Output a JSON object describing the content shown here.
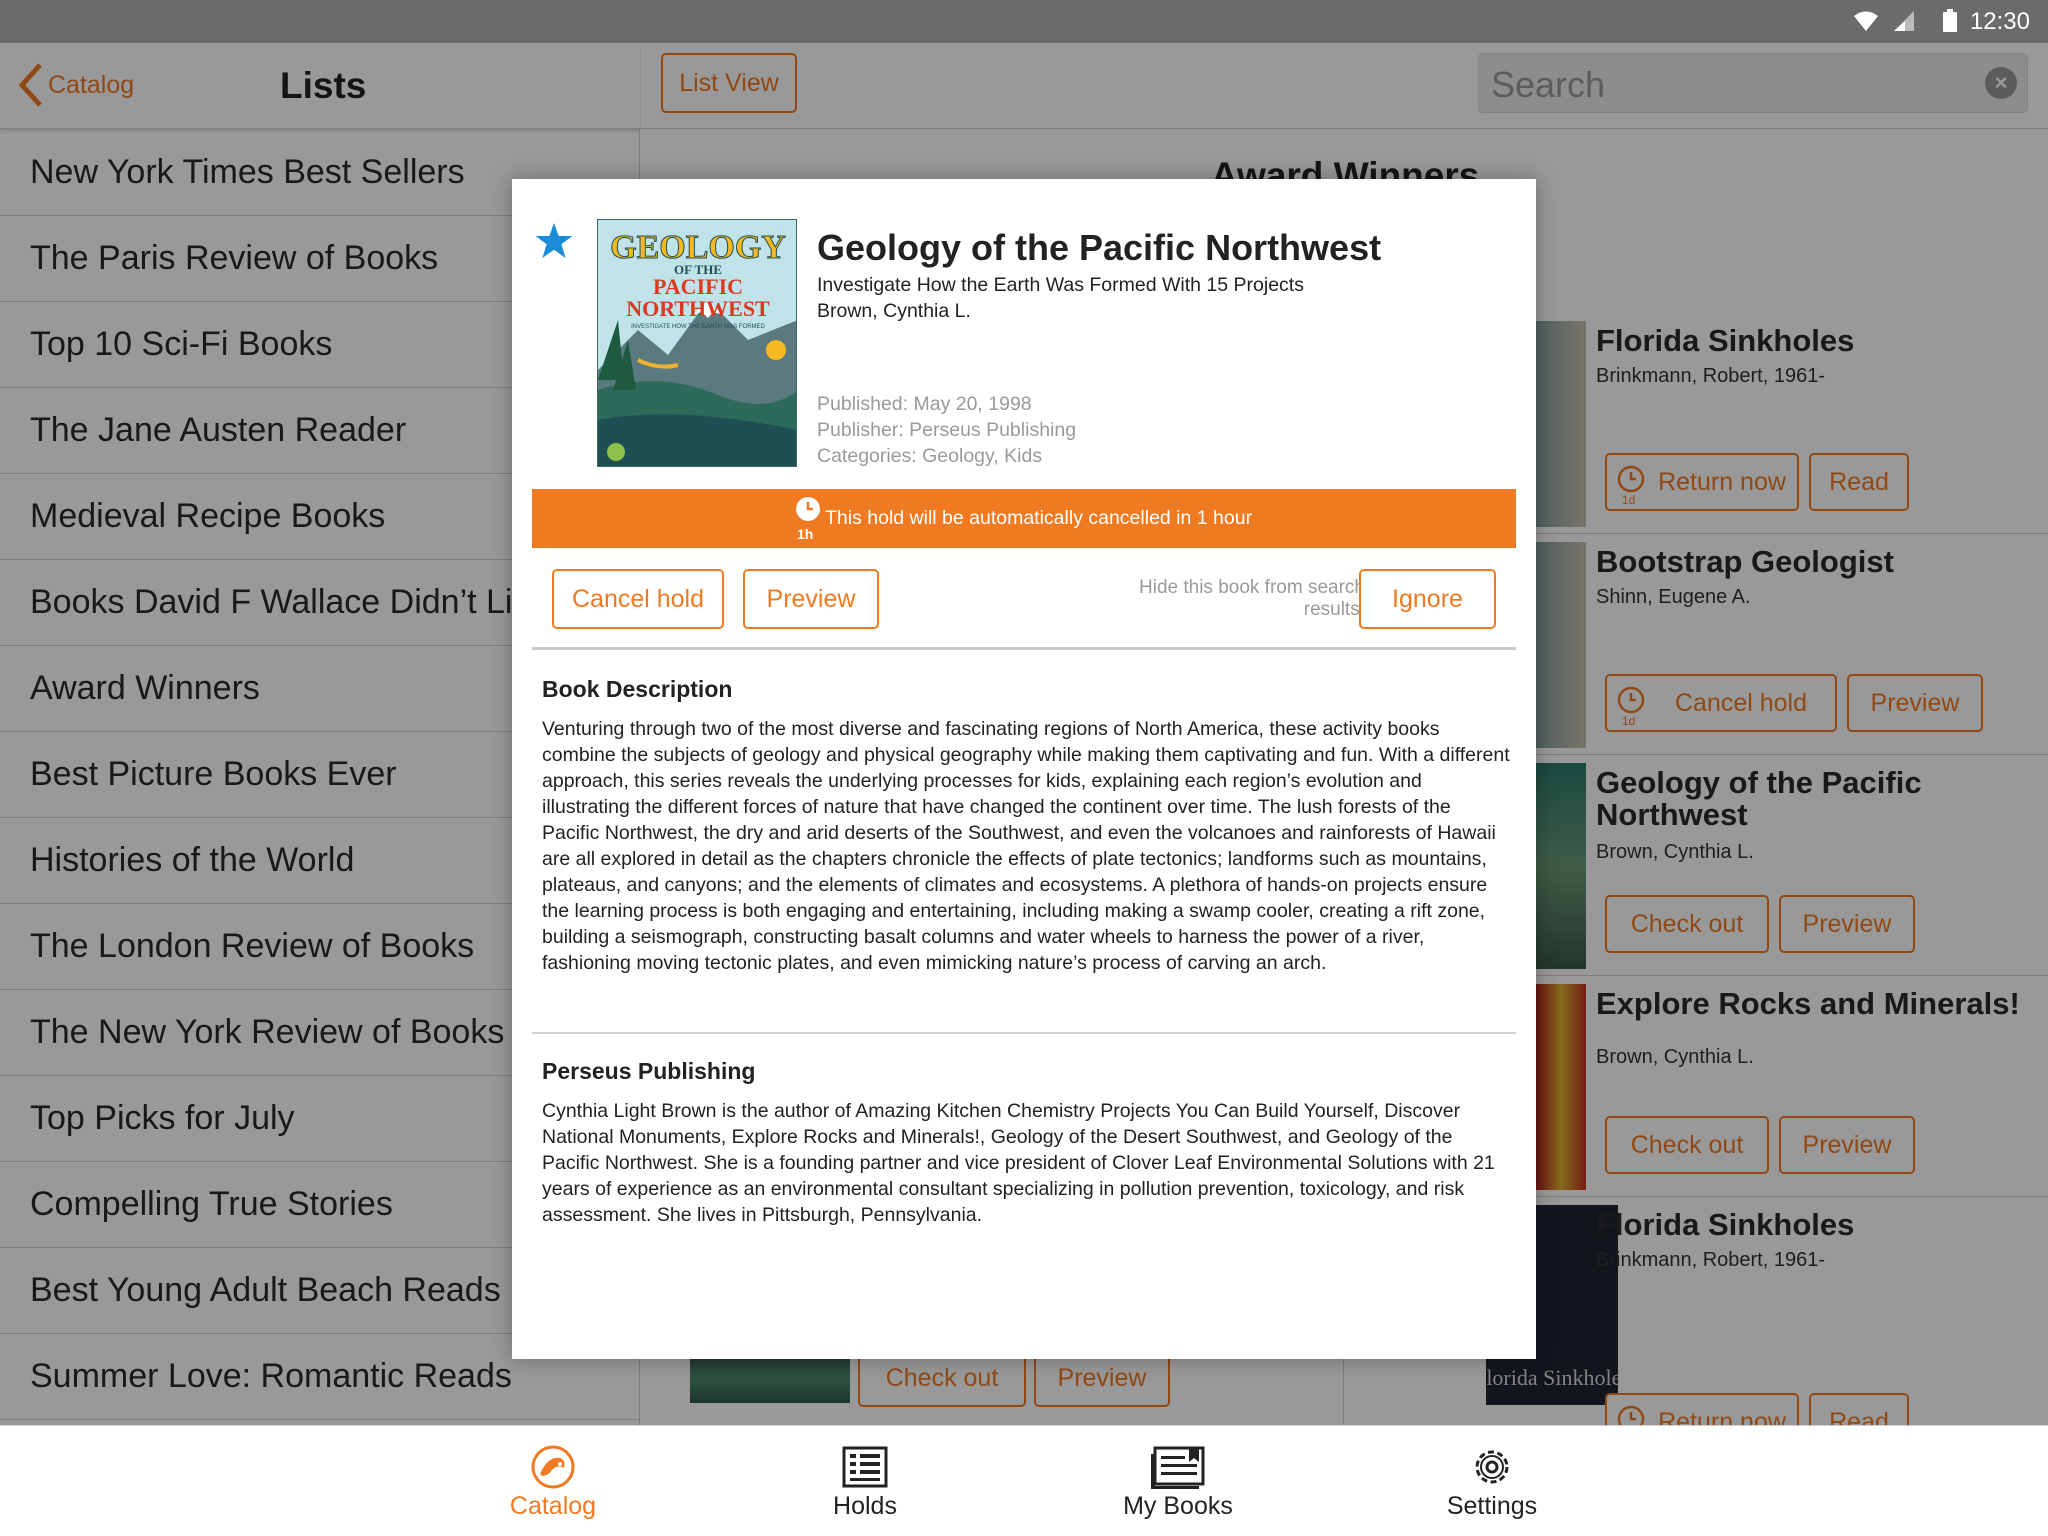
{
  "status_bar": {
    "time": "12:30"
  },
  "left_panel": {
    "back_label": "Catalog",
    "title": "Lists",
    "items": [
      "New York Times Best Sellers",
      "The Paris Review of Books",
      "Top 10 Sci-Fi Books",
      "The Jane Austen Reader",
      "Medieval Recipe Books",
      "Books David F Wallace Didn’t Like",
      "Award Winners",
      "Best Picture Books Ever",
      "Histories of the World",
      "The London Review of Books",
      "The New York Review of Books",
      "Top Picks for July",
      "Compelling True Stories",
      "Best Young Adult Beach Reads",
      "Summer Love: Romantic Reads"
    ]
  },
  "right_panel": {
    "list_view_label": "List View",
    "search_placeholder": "Search",
    "section_title": "Award Winners",
    "cards": [
      {
        "title": "Florida Sinkholes",
        "author": "Brinkmann, Robert, 1961-",
        "badge": "1d",
        "btn1": "Return now",
        "btn2": "Read"
      },
      {
        "title": "Bootstrap Geologist",
        "author": "Shinn, Eugene A.",
        "badge": "1d",
        "btn1": "Cancel hold",
        "btn2": "Preview"
      },
      {
        "title": "Geology of the Pacific Northwest",
        "author": "Brown, Cynthia L.",
        "btn1": "Check out",
        "btn2": "Preview"
      },
      {
        "title": "Explore Rocks and Minerals!",
        "author": "Brown, Cynthia L.",
        "btn1": "Check out",
        "btn2": "Preview"
      },
      {
        "title": "Florida Sinkholes",
        "author": "Brinkmann, Robert, 1961-",
        "badge": "1d",
        "btn1": "Return now",
        "btn2": "Read",
        "cover_text": "Florida Sinkholes"
      }
    ],
    "left_card_buttons": {
      "btn1": "Check out",
      "btn2": "Preview"
    }
  },
  "modal": {
    "title": "Geology of the Pacific Northwest",
    "subtitle": "Investigate How the Earth Was Formed With 15 Projects",
    "author": "Brown, Cynthia L.",
    "published": "Published: May 20, 1998",
    "publisher": "Publisher: Perseus Publishing",
    "categories": "Categories: Geology, Kids",
    "cover": {
      "line1": "GEOLOGY",
      "line2": "OF THE",
      "line3": "PACIFIC",
      "line4": "NORTHWEST",
      "tagline": "INVESTIGATE HOW THE EARTH WAS FORMED"
    },
    "hold_banner": "This hold will be automatically cancelled in 1 hour",
    "hold_badge": "1h",
    "cancel_hold_label": "Cancel hold",
    "preview_label": "Preview",
    "hide_text": "Hide this book from search results:",
    "ignore_label": "Ignore",
    "description_heading": "Book Description",
    "description": "Venturing through two of the most diverse and fascinating regions of North America, these activity books combine the subjects of geology and physical geography while making them captivating and fun. With a different approach, this series reveals the underlying processes for kids, explaining each region’s evolution and illustrating the different forces of nature that have changed the continent over time. The lush forests of the Pacific Northwest, the dry and arid deserts of the Southwest, and even the volcanoes and rainforests of Hawaii are all explored in detail as the chapters chronicle the effects of plate tectonics; landforms such as mountains, plateaus, and canyons; and the elements of climates and ecosystems. A plethora of hands-on projects ensure the learning process is both engaging and entertaining, including making a swamp cooler, creating a rift zone, building a seismograph, constructing basalt columns and water wheels to harness the power of a river, fashioning moving tectonic plates, and even mimicking nature’s process of carving an arch.",
    "publisher_heading": "Perseus Publishing",
    "publisher_text": "Cynthia Light Brown is the author of Amazing Kitchen Chemistry Projects You Can Build Yourself, Discover National Monuments, Explore Rocks and Minerals!, Geology of the Desert Southwest, and Geology of the Pacific Northwest. She is a founding partner and vice president of Clover Leaf Environmental Solutions with 21 years of experience as an environmental consultant specializing in pollution prevention, toxicology, and risk assessment. She lives in Pittsburgh, Pennsylvania."
  },
  "bottom_nav": {
    "catalog": "Catalog",
    "holds": "Holds",
    "my_books": "My Books",
    "settings": "Settings"
  },
  "colors": {
    "accent": "#f07a22",
    "star": "#1a8cd8"
  }
}
